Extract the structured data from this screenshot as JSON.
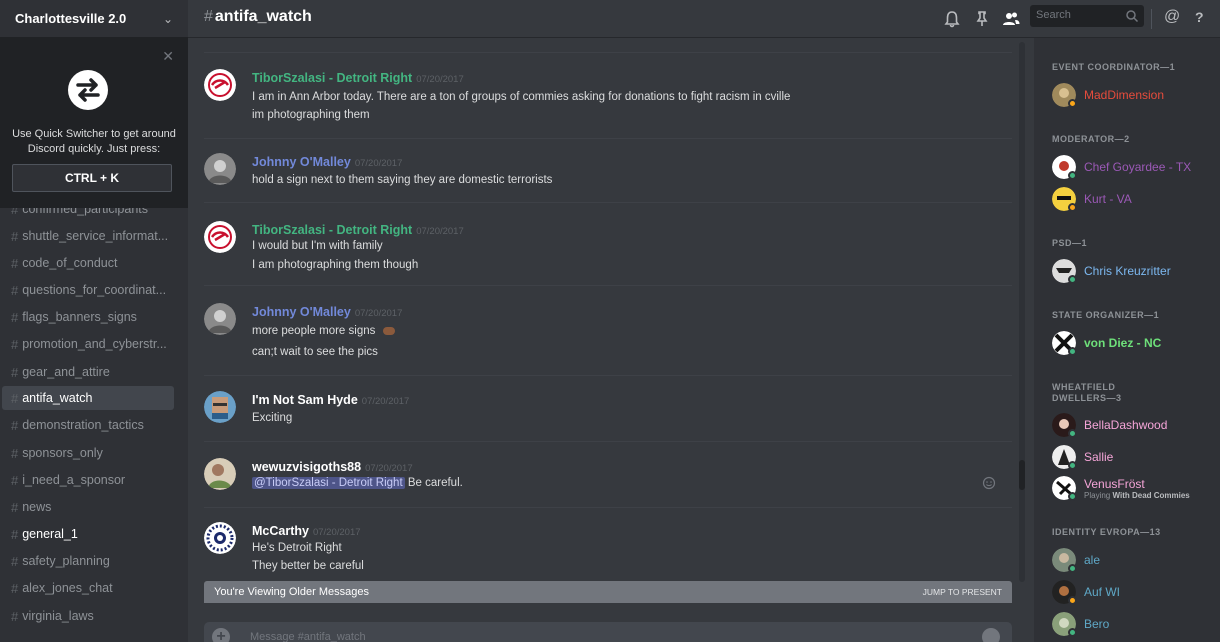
{
  "server": {
    "name": "Charlottesville 2.0"
  },
  "switcher": {
    "text": "Use Quick Switcher to get around Discord quickly. Just press:",
    "shortcut": "CTRL + K"
  },
  "channels": [
    {
      "name": "confirmed_participants"
    },
    {
      "name": "shuttle_service_informat..."
    },
    {
      "name": "code_of_conduct"
    },
    {
      "name": "questions_for_coordinat..."
    },
    {
      "name": "flags_banners_signs"
    },
    {
      "name": "promotion_and_cyberstr..."
    },
    {
      "name": "gear_and_attire"
    },
    {
      "name": "antifa_watch",
      "active": true
    },
    {
      "name": "demonstration_tactics"
    },
    {
      "name": "sponsors_only"
    },
    {
      "name": "i_need_a_sponsor"
    },
    {
      "name": "news"
    },
    {
      "name": "general_1",
      "bold": true
    },
    {
      "name": "safety_planning"
    },
    {
      "name": "alex_jones_chat"
    },
    {
      "name": "virginia_laws"
    }
  ],
  "header": {
    "channel": "antifa_watch",
    "search_placeholder": "Search"
  },
  "messages": [
    {
      "author": "TiborSzalasi - Detroit Right",
      "color": "#43b581",
      "timestamp": "07/20/2017",
      "lines": [
        "I am in Ann Arbor today. There are a ton of groups of commies asking for donations to fight racism in cville",
        "im photographing them"
      ]
    },
    {
      "author": "Johnny O'Malley",
      "color": "#7289da",
      "timestamp": "07/20/2017",
      "lines": [
        "hold a sign next to them saying they are domestic terrorists"
      ]
    },
    {
      "author": "TiborSzalasi - Detroit Right",
      "color": "#43b581",
      "timestamp": "07/20/2017",
      "lines": [
        "I would but I'm with family",
        "I am photographing them though"
      ]
    },
    {
      "author": "Johnny O'Malley",
      "color": "#7289da",
      "timestamp": "07/20/2017",
      "lines": [
        "more people more signs",
        "can;t wait to see the pics"
      ]
    },
    {
      "author": "I'm Not Sam Hyde",
      "color": "#ffffff",
      "timestamp": "07/20/2017",
      "lines": [
        "Exciting"
      ]
    },
    {
      "author": "wewuzvisigoths88",
      "color": "#ffffff",
      "timestamp": "07/20/2017",
      "mention": "@TiborSzalasi - Detroit Right",
      "lines": [
        "Be careful."
      ]
    },
    {
      "author": "McCarthy",
      "color": "#ffffff",
      "timestamp": "07/20/2017",
      "lines": [
        "He's Detroit Right",
        "They better be careful"
      ]
    }
  ],
  "older_bar": {
    "text": "You're Viewing Older Messages",
    "jump": "JUMP TO PRESENT"
  },
  "composer": {
    "placeholder": "Message #antifa_watch"
  },
  "members": {
    "groups": [
      {
        "title": "EVENT COORDINATOR—1",
        "members": [
          {
            "name": "MadDimension",
            "color": "#e74c3c",
            "status": "#faa61a"
          }
        ]
      },
      {
        "title": "MODERATOR—2",
        "members": [
          {
            "name": "Chef Goyardee - TX",
            "color": "#9b59b6",
            "status": "#43b581"
          },
          {
            "name": "Kurt - VA",
            "color": "#9b59b6",
            "status": "#faa61a"
          }
        ]
      },
      {
        "title": "PSD—1",
        "members": [
          {
            "name": "Chris Kreuzritter",
            "color": "#7cb8f0",
            "status": "#43b581"
          }
        ]
      },
      {
        "title": "STATE ORGANIZER—1",
        "members": [
          {
            "name": "von Diez - NC",
            "color": "#6ee07a",
            "status": "#43b581"
          }
        ]
      },
      {
        "title": "WHEATFIELD DWELLERS—3",
        "members": [
          {
            "name": "BellaDashwood",
            "color": "#f5a5d8",
            "status": "#43b581"
          },
          {
            "name": "Sallie",
            "color": "#f5a5d8",
            "status": "#43b581"
          },
          {
            "name": "VenusFröst",
            "color": "#f5a5d8",
            "status": "#43b581",
            "activity_prefix": "Playing",
            "activity": "With Dead Commies"
          }
        ]
      },
      {
        "title": "IDENTITY EVROPA—13",
        "members": [
          {
            "name": "ale",
            "color": "#5fa8c7",
            "status": "#43b581"
          },
          {
            "name": "Auf WI",
            "color": "#5fa8c7",
            "status": "#faa61a"
          },
          {
            "name": "Bero",
            "color": "#5fa8c7",
            "status": "#43b581"
          }
        ]
      }
    ]
  }
}
